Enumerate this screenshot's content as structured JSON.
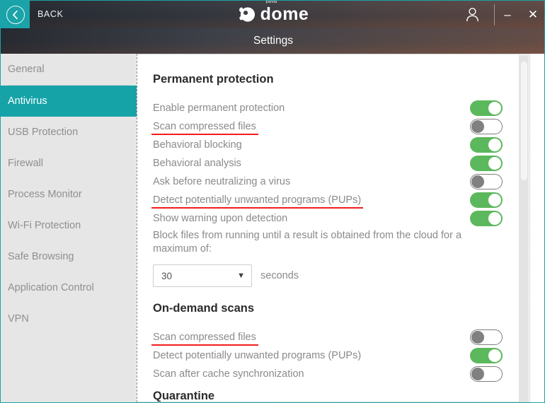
{
  "window": {
    "back_label": "BACK",
    "back_icon": "chevron-left-circle-icon",
    "logo_sup": "panda",
    "logo_text": "dome",
    "account_icon": "user-account-icon",
    "minimize_glyph": "–",
    "close_glyph": "✕",
    "accent_color": "#16a3a8"
  },
  "subheader": {
    "title": "Settings"
  },
  "sidebar": {
    "items": [
      {
        "label": "General",
        "active": false
      },
      {
        "label": "Antivirus",
        "active": true
      },
      {
        "label": "USB Protection",
        "active": false
      },
      {
        "label": "Firewall",
        "active": false
      },
      {
        "label": "Process Monitor",
        "active": false
      },
      {
        "label": "Wi-Fi Protection",
        "active": false
      },
      {
        "label": "Safe Browsing",
        "active": false
      },
      {
        "label": "Application Control",
        "active": false
      },
      {
        "label": "VPN",
        "active": false
      }
    ]
  },
  "content": {
    "permanent_protection": {
      "title": "Permanent protection",
      "rows": [
        {
          "label": "Enable permanent protection",
          "state": "on",
          "highlighted": false
        },
        {
          "label": "Scan compressed files",
          "state": "off",
          "highlighted": true
        },
        {
          "label": "Behavioral blocking",
          "state": "on",
          "highlighted": false
        },
        {
          "label": "Behavioral analysis",
          "state": "on",
          "highlighted": false
        },
        {
          "label": "Ask before neutralizing a virus",
          "state": "off",
          "highlighted": false
        },
        {
          "label": "Detect potentially unwanted programs (PUPs)",
          "state": "on",
          "highlighted": true
        },
        {
          "label": "Show warning upon detection",
          "state": "on",
          "highlighted": false
        }
      ],
      "block_text": "Block files from running until a result is obtained from the cloud for a maximum of:",
      "timeout_value": "30",
      "timeout_unit": "seconds",
      "caret_glyph": "▼"
    },
    "on_demand_scans": {
      "title": "On-demand scans",
      "rows": [
        {
          "label": "Scan compressed files",
          "state": "off",
          "highlighted": true
        },
        {
          "label": "Detect potentially unwanted programs (PUPs)",
          "state": "on",
          "highlighted": false
        },
        {
          "label": "Scan after cache synchronization",
          "state": "off",
          "highlighted": false
        }
      ]
    },
    "quarantine": {
      "title": "Quarantine"
    }
  }
}
